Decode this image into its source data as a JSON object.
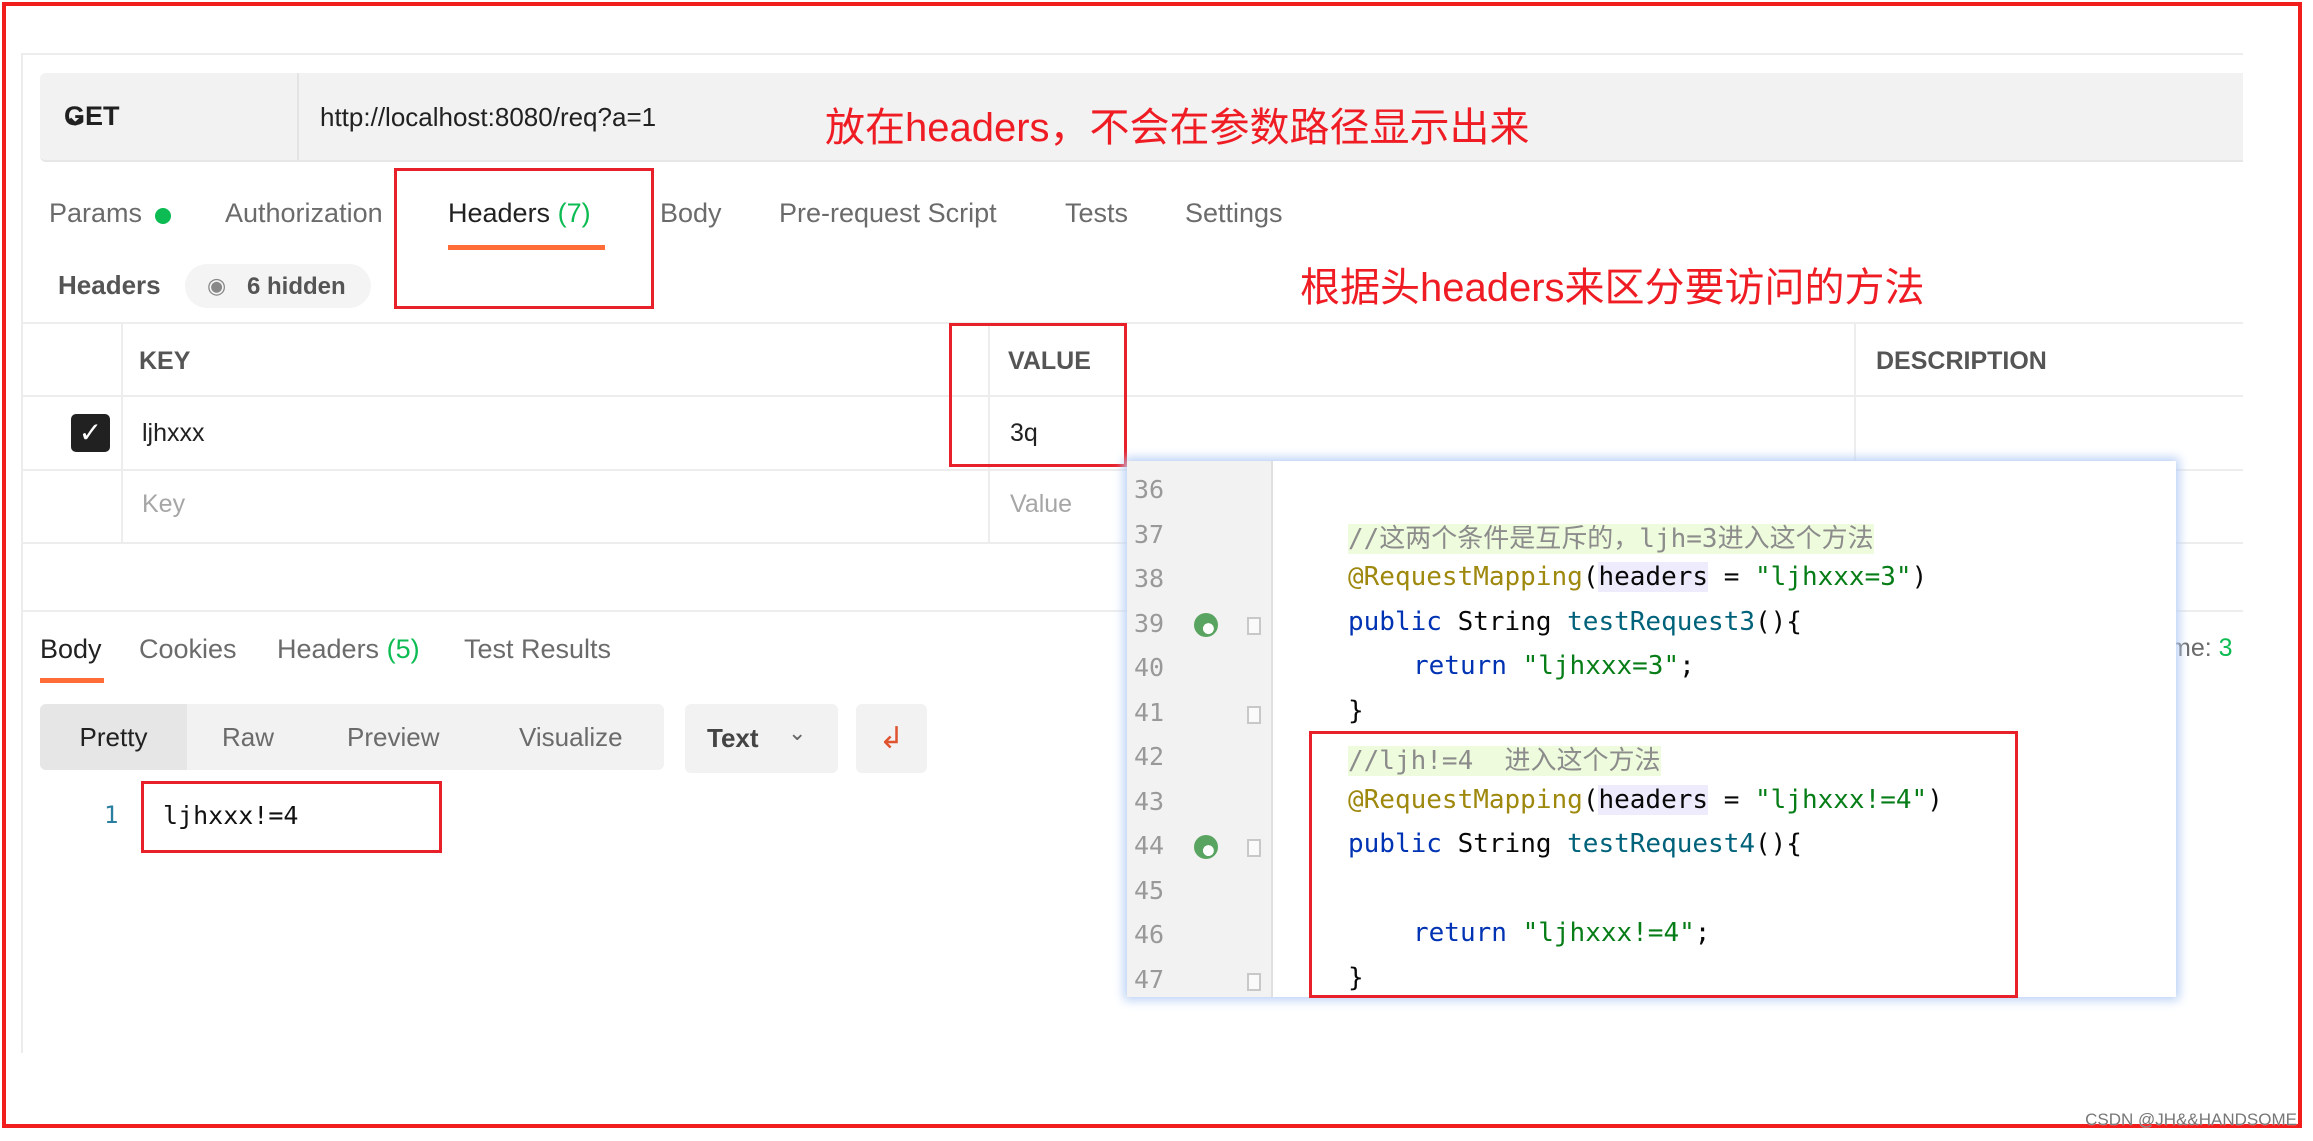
{
  "request": {
    "method": "GET",
    "url": "http://localhost:8080/req?a=1"
  },
  "annotations": {
    "url_note": "放在headers，不会在参数路径显示出来",
    "headers_note": "根据头headers来区分要访问的方法"
  },
  "request_tabs": [
    {
      "label": "Params"
    },
    {
      "label": "Authorization"
    },
    {
      "label": "Headers",
      "count": "(7)"
    },
    {
      "label": "Body"
    },
    {
      "label": "Pre-request Script"
    },
    {
      "label": "Tests"
    },
    {
      "label": "Settings"
    }
  ],
  "headers_section": {
    "label": "Headers",
    "hidden_label": "6 hidden",
    "columns": [
      "KEY",
      "VALUE",
      "DESCRIPTION"
    ],
    "rows": [
      {
        "checked": true,
        "key": "ljhxxx",
        "value": "3q",
        "description": ""
      }
    ],
    "placeholder": {
      "key": "Key",
      "value": "Value"
    }
  },
  "response_tabs": [
    {
      "label": "Body"
    },
    {
      "label": "Cookies"
    },
    {
      "label": "Headers",
      "count": "(5)"
    },
    {
      "label": "Test Results"
    }
  ],
  "response_meta": {
    "time_partial_label": "me: ",
    "time_partial_value": "3"
  },
  "view_modes": [
    "Pretty",
    "Raw",
    "Preview",
    "Visualize"
  ],
  "format_select": "Text",
  "response_body": {
    "line": "1",
    "text": "ljhxxx!=4"
  },
  "code_editor": {
    "lines": [
      {
        "n": "36",
        "indent": 0,
        "tokens": []
      },
      {
        "n": "37",
        "indent": 0,
        "tokens": [
          {
            "t": "//这两个条件是互斥的，ljh=3进入这个方法",
            "c": "cmt"
          }
        ]
      },
      {
        "n": "38",
        "indent": 0,
        "tokens": [
          {
            "t": "@RequestMapping",
            "c": "ann"
          },
          {
            "t": "(",
            "c": ""
          },
          {
            "t": "headers",
            "c": "hl"
          },
          {
            "t": " = ",
            "c": ""
          },
          {
            "t": "\"ljhxxx=3\"",
            "c": "str"
          },
          {
            "t": ")",
            "c": ""
          }
        ]
      },
      {
        "n": "39",
        "indent": 0,
        "icon": true,
        "fold": true,
        "tokens": [
          {
            "t": "public",
            "c": "kw"
          },
          {
            "t": " String ",
            "c": ""
          },
          {
            "t": "testRequest3",
            "c": "fn"
          },
          {
            "t": "(){",
            "c": ""
          }
        ]
      },
      {
        "n": "40",
        "indent": 1,
        "tokens": [
          {
            "t": "return",
            "c": "kw"
          },
          {
            "t": " ",
            "c": ""
          },
          {
            "t": "\"ljhxxx=3\"",
            "c": "str"
          },
          {
            "t": ";",
            "c": ""
          }
        ]
      },
      {
        "n": "41",
        "indent": 0,
        "fold": true,
        "tokens": [
          {
            "t": "}",
            "c": ""
          }
        ]
      },
      {
        "n": "42",
        "indent": 0,
        "tokens": [
          {
            "t": "//ljh!=4  进入这个方法",
            "c": "cmt"
          }
        ]
      },
      {
        "n": "43",
        "indent": 0,
        "tokens": [
          {
            "t": "@RequestMapping",
            "c": "ann"
          },
          {
            "t": "(",
            "c": ""
          },
          {
            "t": "headers",
            "c": "hl"
          },
          {
            "t": " = ",
            "c": ""
          },
          {
            "t": "\"ljhxxx!=4\"",
            "c": "str"
          },
          {
            "t": ")",
            "c": ""
          }
        ]
      },
      {
        "n": "44",
        "indent": 0,
        "icon": true,
        "fold": true,
        "tokens": [
          {
            "t": "public",
            "c": "kw"
          },
          {
            "t": " String ",
            "c": ""
          },
          {
            "t": "testRequest4",
            "c": "fn"
          },
          {
            "t": "(){",
            "c": ""
          }
        ]
      },
      {
        "n": "45",
        "indent": 0,
        "tokens": []
      },
      {
        "n": "46",
        "indent": 1,
        "tokens": [
          {
            "t": "return",
            "c": "kw"
          },
          {
            "t": " ",
            "c": ""
          },
          {
            "t": "\"ljhxxx!=4\"",
            "c": "str"
          },
          {
            "t": ";",
            "c": ""
          }
        ]
      },
      {
        "n": "47",
        "indent": 0,
        "fold": true,
        "tokens": [
          {
            "t": "}",
            "c": ""
          }
        ]
      }
    ]
  },
  "watermark": "CSDN @JH&&HANDSOME",
  "colors": {
    "accent": "#ff6c37",
    "annotation_red": "#ef1c24",
    "success_green": "#0cbb52"
  }
}
